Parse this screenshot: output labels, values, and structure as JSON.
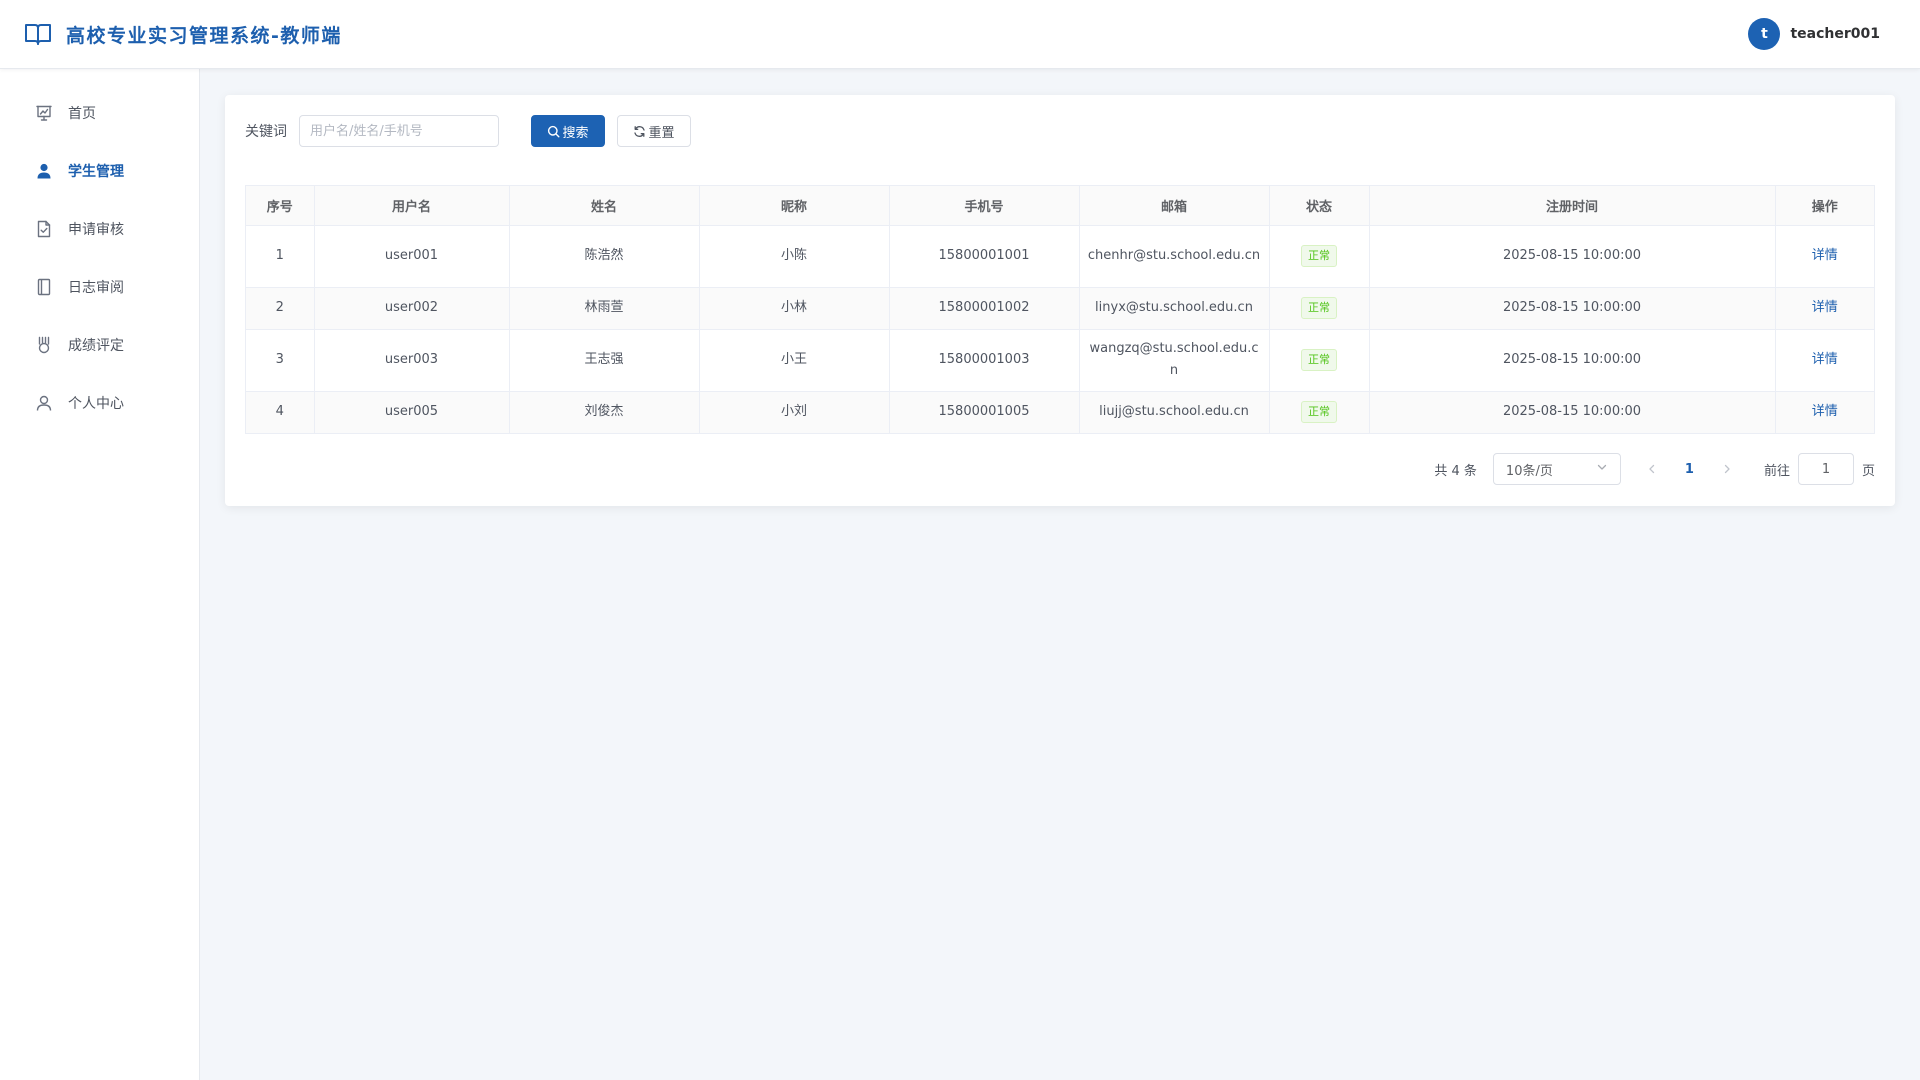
{
  "header": {
    "title": "高校专业实习管理系统-教师端",
    "avatar_letter": "t",
    "username": "teacher001"
  },
  "sidebar": {
    "items": [
      {
        "label": "首页",
        "icon": "presentation-icon",
        "active": false
      },
      {
        "label": "学生管理",
        "icon": "user-icon",
        "active": true
      },
      {
        "label": "申请审核",
        "icon": "document-check-icon",
        "active": false
      },
      {
        "label": "日志审阅",
        "icon": "notebook-icon",
        "active": false
      },
      {
        "label": "成绩评定",
        "icon": "medal-icon",
        "active": false
      },
      {
        "label": "个人中心",
        "icon": "user-outline-icon",
        "active": false
      }
    ]
  },
  "search": {
    "label": "关键词",
    "placeholder": "用户名/姓名/手机号",
    "value": "",
    "search_button": "搜索",
    "reset_button": "重置"
  },
  "table": {
    "columns": [
      "序号",
      "用户名",
      "姓名",
      "昵称",
      "手机号",
      "邮箱",
      "状态",
      "注册时间",
      "操作"
    ],
    "rows": [
      {
        "index": "1",
        "username": "user001",
        "name": "陈浩然",
        "nickname": "小陈",
        "phone": "15800001001",
        "email": "chenhr@stu.school.edu.cn",
        "status": "正常",
        "registered": "2025-08-15 10:00:00",
        "action": "详情"
      },
      {
        "index": "2",
        "username": "user002",
        "name": "林雨萱",
        "nickname": "小林",
        "phone": "15800001002",
        "email": "linyx@stu.school.edu.cn",
        "status": "正常",
        "registered": "2025-08-15 10:00:00",
        "action": "详情"
      },
      {
        "index": "3",
        "username": "user003",
        "name": "王志强",
        "nickname": "小王",
        "phone": "15800001003",
        "email": "wangzq@stu.school.edu.cn",
        "status": "正常",
        "registered": "2025-08-15 10:00:00",
        "action": "详情"
      },
      {
        "index": "4",
        "username": "user005",
        "name": "刘俊杰",
        "nickname": "小刘",
        "phone": "15800001005",
        "email": "liujj@stu.school.edu.cn",
        "status": "正常",
        "registered": "2025-08-15 10:00:00",
        "action": "详情"
      }
    ]
  },
  "pagination": {
    "total_text": "共 4 条",
    "page_size": "10条/页",
    "current_page": "1",
    "goto_prefix": "前往",
    "goto_value": "1",
    "goto_suffix": "页"
  },
  "colors": {
    "primary": "#1d62b3",
    "title": "#1d5fae",
    "status_normal": "#52c41a",
    "background": "#f3f6fa"
  }
}
